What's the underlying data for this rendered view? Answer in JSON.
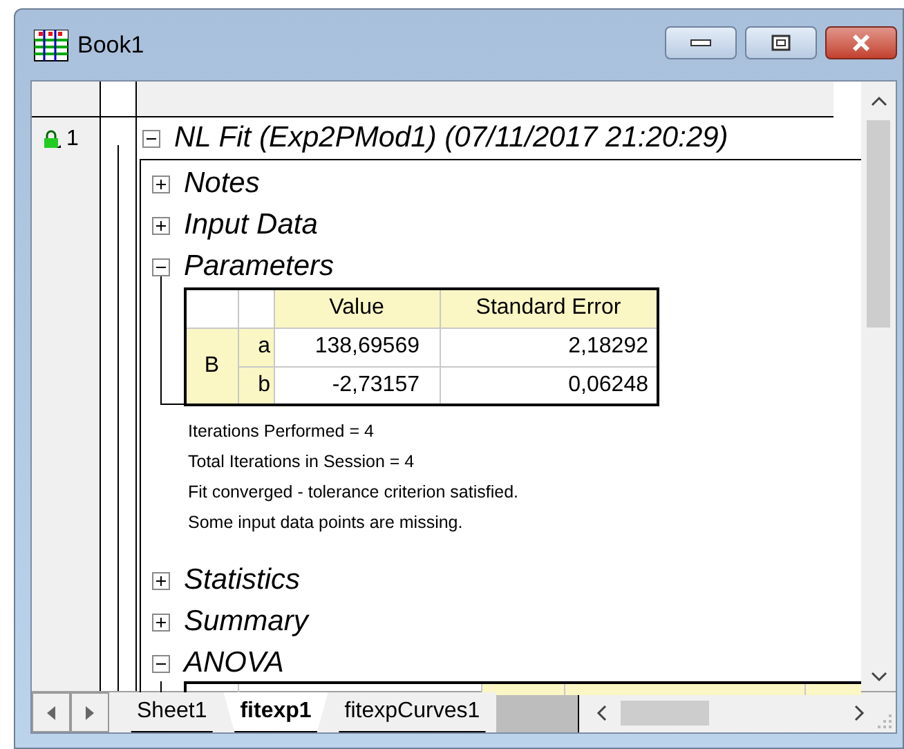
{
  "window": {
    "title": "Book1"
  },
  "row": {
    "number": "1"
  },
  "report": {
    "title": "NL Fit (Exp2PMod1) (07/11/2017 21:20:29)",
    "expanded": true,
    "sections": [
      {
        "kind": "heading",
        "label": "Notes",
        "expanded": false
      },
      {
        "kind": "heading",
        "label": "Input Data",
        "expanded": false
      },
      {
        "kind": "params",
        "label": "Parameters",
        "expanded": true,
        "table": {
          "columns": [
            "Value",
            "Standard Error"
          ],
          "group": "B",
          "rows": [
            {
              "param": "a",
              "value": "138,69569",
              "error": "2,18292"
            },
            {
              "param": "b",
              "value": "-2,73157",
              "error": "0,06248"
            }
          ]
        },
        "notes": [
          "Iterations Performed = 4",
          "Total Iterations in Session = 4",
          "Fit converged - tolerance criterion satisfied.",
          "Some input data points are missing."
        ]
      },
      {
        "kind": "heading",
        "label": "Statistics",
        "expanded": false
      },
      {
        "kind": "heading",
        "label": "Summary",
        "expanded": false
      },
      {
        "kind": "cut",
        "label": "ANOVA",
        "expanded": true
      }
    ]
  },
  "sheet_tabs": [
    {
      "label": "Sheet1",
      "selected": false
    },
    {
      "label": "fitexp1",
      "selected": true
    },
    {
      "label": "fitexpCurves1",
      "selected": false
    }
  ]
}
